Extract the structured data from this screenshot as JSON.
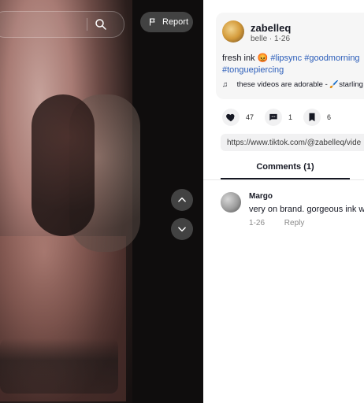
{
  "controls": {
    "report_label": "Report"
  },
  "post": {
    "username": "zabelleq",
    "display_name": "belle",
    "date": "1-26",
    "caption_text": "fresh ink",
    "caption_emoji": "😡",
    "hashtags": [
      "#lipsync",
      "#goodmorning",
      "#tonguepiercing"
    ],
    "sound_text": "these videos are adorable -",
    "sound_emoji": "🖌️",
    "sound_author": "starling",
    "likes": "47",
    "comments": "1",
    "saves": "6",
    "link": "https://www.tiktok.com/@zabelleq/vide"
  },
  "tabs": {
    "comments_label": "Comments (1)"
  },
  "comments": [
    {
      "author": "Margo",
      "text": "very on brand. gorgeous ink w",
      "date": "1-26",
      "reply_label": "Reply"
    }
  ],
  "icons": {
    "search": "search-icon",
    "report": "flag-icon",
    "up": "chevron-up-icon",
    "down": "chevron-down-icon",
    "like": "heart-icon",
    "comment": "comment-icon",
    "save": "bookmark-icon",
    "sound": "music-note-icon"
  }
}
